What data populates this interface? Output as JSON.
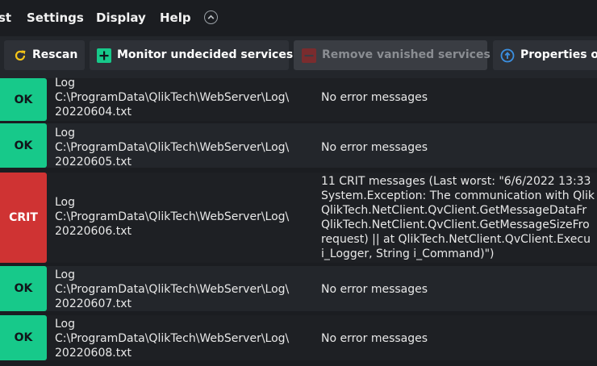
{
  "menu": {
    "partial_item": "st",
    "settings": "Settings",
    "display": "Display",
    "help": "Help"
  },
  "toolbar": {
    "rescan": "Rescan",
    "monitor": "Monitor undecided services",
    "remove": "Remove vanished services",
    "properties": "Properties of"
  },
  "colors": {
    "ok": "#17c98a",
    "crit": "#cf3333",
    "background": "#1b1d21"
  },
  "rows": [
    {
      "status": "OK",
      "path": "Log\nC:\\ProgramData\\QlikTech\\WebServer\\Log\\\n20220604.txt",
      "message": "No error messages"
    },
    {
      "status": "OK",
      "path": "Log\nC:\\ProgramData\\QlikTech\\WebServer\\Log\\\n20220605.txt",
      "message": "No error messages"
    },
    {
      "status": "CRIT",
      "path": "Log\nC:\\ProgramData\\QlikTech\\WebServer\\Log\\\n20220606.txt",
      "message": "11 CRIT messages (Last worst: \"6/6/2022 13:33\nSystem.Exception: The communication with Qlik\nQlikTech.NetClient.QvClient.GetMessageDataFr\nQlikTech.NetClient.QvClient.GetMessageSizeFro\nrequest) || at QlikTech.NetClient.QvClient.Execu\ni_Logger, String i_Command)\")"
    },
    {
      "status": "OK",
      "path": "Log\nC:\\ProgramData\\QlikTech\\WebServer\\Log\\\n20220607.txt",
      "message": "No error messages"
    },
    {
      "status": "OK",
      "path": "Log\nC:\\ProgramData\\QlikTech\\WebServer\\Log\\\n20220608.txt",
      "message": "No error messages"
    }
  ]
}
